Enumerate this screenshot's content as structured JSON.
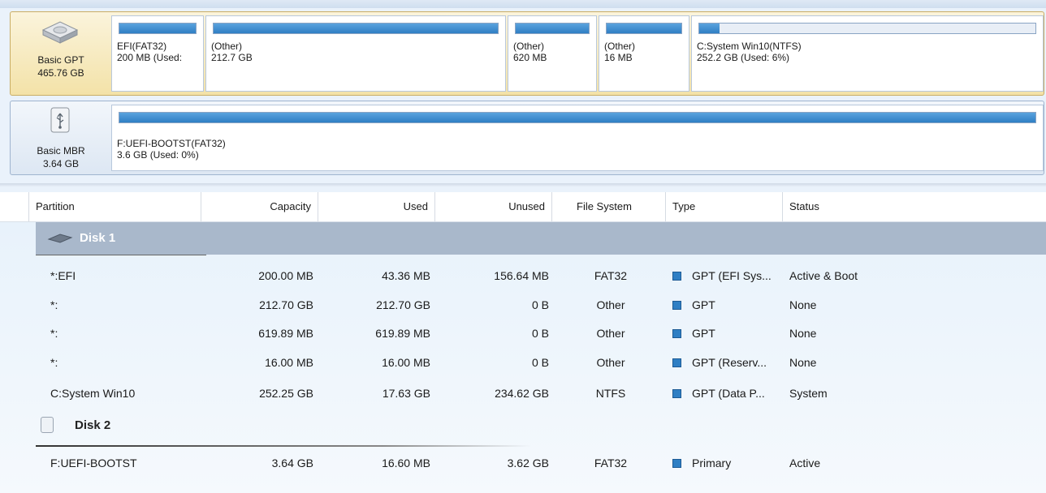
{
  "disks": [
    {
      "label": "Basic GPT",
      "size": "465.76 GB",
      "icon": "hard-disk-icon",
      "partitions": [
        {
          "name": "EFI(FAT32)",
          "size": "200 MB (Used:",
          "used_fraction": 1.0
        },
        {
          "name": "(Other)",
          "size": "212.7 GB",
          "used_fraction": 1.0
        },
        {
          "name": "(Other)",
          "size": "620 MB",
          "used_fraction": 1.0
        },
        {
          "name": "(Other)",
          "size": "16 MB",
          "used_fraction": 1.0
        },
        {
          "name": "C:System Win10(NTFS)",
          "size": "252.2 GB (Used: 6%)",
          "used_fraction": 0.06
        }
      ]
    },
    {
      "label": "Basic MBR",
      "size": "3.64 GB",
      "icon": "usb-drive-icon",
      "partitions": [
        {
          "name": "F:UEFI-BOOTST(FAT32)",
          "size": "3.6 GB (Used: 0%)",
          "used_fraction": 0.0
        }
      ]
    }
  ],
  "table": {
    "headers": {
      "partition": "Partition",
      "capacity": "Capacity",
      "used": "Used",
      "unused": "Unused",
      "file_system": "File System",
      "type": "Type",
      "status": "Status"
    },
    "groups": [
      {
        "title": "Disk 1",
        "rows": [
          {
            "partition": "*:EFI",
            "capacity": "200.00 MB",
            "used": "43.36 MB",
            "unused": "156.64 MB",
            "fs": "FAT32",
            "type": "GPT (EFI Sys...",
            "status": "Active & Boot"
          },
          {
            "partition": "*:",
            "capacity": "212.70 GB",
            "used": "212.70 GB",
            "unused": "0 B",
            "fs": "Other",
            "type": "GPT",
            "status": "None"
          },
          {
            "partition": "*:",
            "capacity": "619.89 MB",
            "used": "619.89 MB",
            "unused": "0 B",
            "fs": "Other",
            "type": "GPT",
            "status": "None"
          },
          {
            "partition": "*:",
            "capacity": "16.00 MB",
            "used": "16.00 MB",
            "unused": "0 B",
            "fs": "Other",
            "type": "GPT (Reserv...",
            "status": "None"
          },
          {
            "partition": "C:System Win10",
            "capacity": "252.25 GB",
            "used": "17.63 GB",
            "unused": "234.62 GB",
            "fs": "NTFS",
            "type": "GPT (Data P...",
            "status": "System"
          }
        ]
      },
      {
        "title": "Disk 2",
        "rows": [
          {
            "partition": "F:UEFI-BOOTST",
            "capacity": "3.64 GB",
            "used": "16.60 MB",
            "unused": "3.62 GB",
            "fs": "FAT32",
            "type": "Primary",
            "status": "Active"
          }
        ]
      }
    ]
  },
  "colors": {
    "accent": "#2f7fc4",
    "selected_disk": "#f3e2a8",
    "group_header": "#a9b8cb"
  }
}
